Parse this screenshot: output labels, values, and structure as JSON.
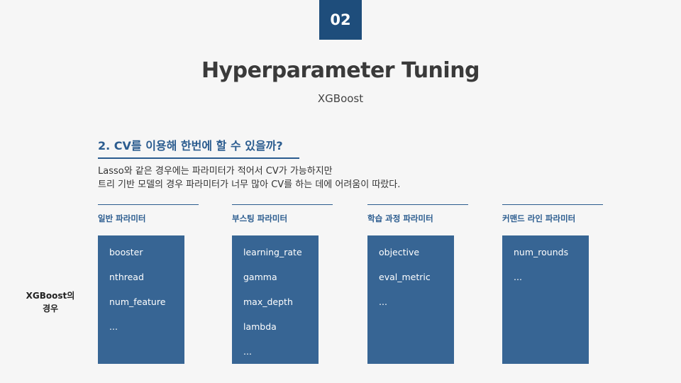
{
  "slide_number": "02",
  "title": "Hyperparameter Tuning",
  "subtitle": "XGBoost",
  "section_heading": "2. CV를 이용해 한번에 할 수 있을까?",
  "description": [
    "Lasso와 같은 경우에는 파라미터가 적어서 CV가 가능하지만",
    "트리 기반 모델의 경우 파라미터가 너무 많아 CV를 하는 데에 어려움이 따랐다."
  ],
  "row_label": [
    "XGBoost의",
    "경우"
  ],
  "columns": [
    {
      "label": "일반 파라미터",
      "items": [
        "booster",
        "nthread",
        "num_feature",
        "..."
      ]
    },
    {
      "label": "부스팅 파라미터",
      "items": [
        "learning_rate",
        "gamma",
        "max_depth",
        "lambda",
        "..."
      ]
    },
    {
      "label": "학습 과정 파라미터",
      "items": [
        "objective",
        "eval_metric",
        "..."
      ]
    },
    {
      "label": "커맨드 라인 파라미터",
      "items": [
        "num_rounds",
        "..."
      ]
    }
  ],
  "colors": {
    "accent": "#2b5c8f",
    "badge": "#1e4d7b",
    "box": "#376594",
    "background": "#f6f6f6"
  }
}
